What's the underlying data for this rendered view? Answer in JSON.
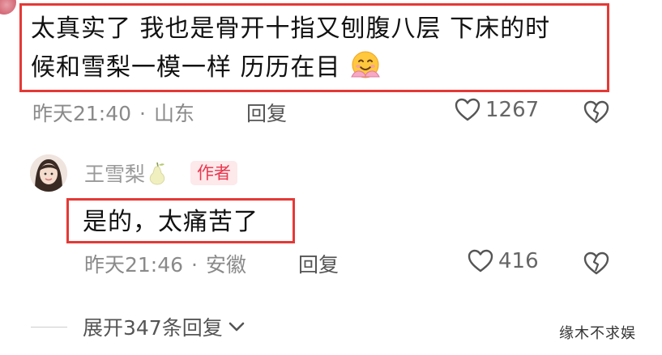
{
  "comment": {
    "text_line1": "太真实了 我也是骨开十指又刨腹八层 下床的时",
    "text_line2": "候和雪梨一模一样 历历在目",
    "emoji": "hug-emoji",
    "time": "昨天21:40",
    "separator": "·",
    "location": "山东",
    "reply_label": "回复",
    "likes": "1267"
  },
  "reply": {
    "author": "王雪梨",
    "author_badge": "作者",
    "text": "是的，太痛苦了",
    "time": "昨天21:46",
    "separator": "·",
    "location": "安徽",
    "reply_label": "回复",
    "likes": "416"
  },
  "expand": {
    "label": "展开347条回复"
  },
  "watermark": "缘木不求娱",
  "colors": {
    "highlight_border": "#e53935",
    "badge_bg": "#fde8ea",
    "badge_text": "#e8384f",
    "meta_text": "#8a8a8a"
  }
}
